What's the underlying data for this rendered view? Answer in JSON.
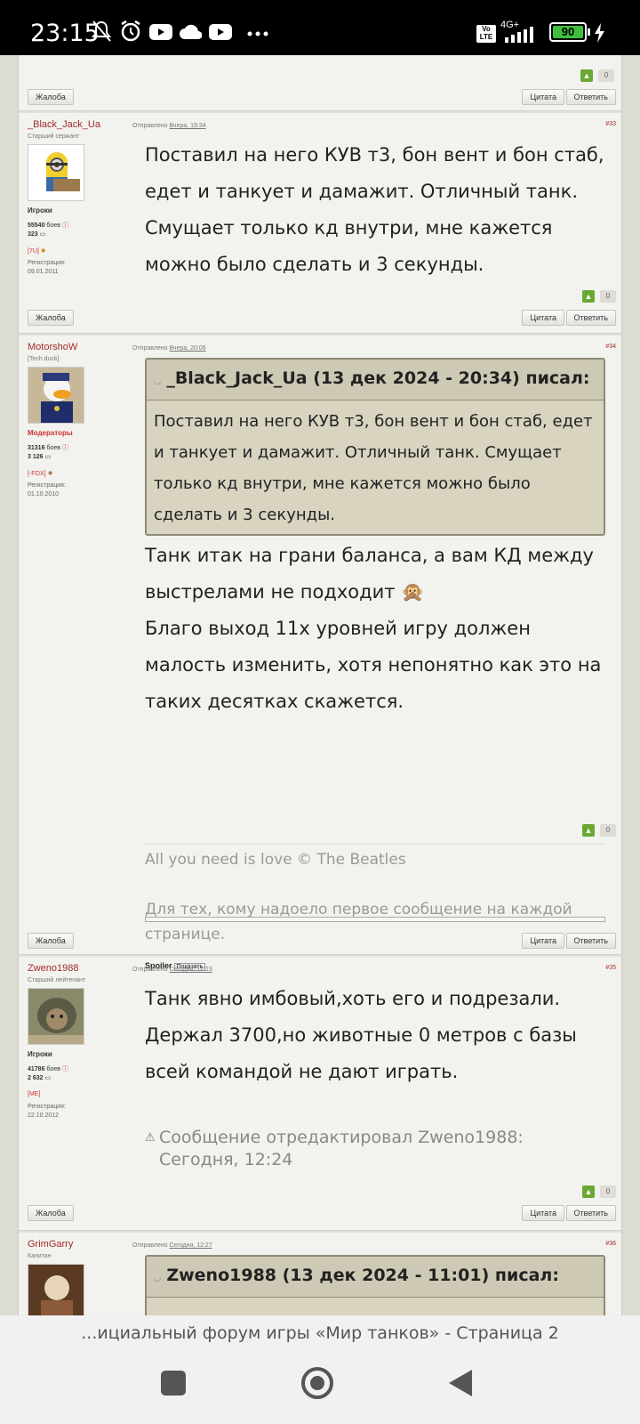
{
  "status_bar": {
    "time": "23:15",
    "battery": "90",
    "network": "4G+",
    "volte": "Vo LTE"
  },
  "forum": {
    "top": {
      "vote_count": "0",
      "report_label": "Жалоба",
      "quote_label": "Цитата",
      "reply_label": "Ответить"
    },
    "posts": [
      {
        "author": "_Black_Jack_Ua",
        "rank": "Старший сержант",
        "group": "Игроки",
        "battles": "55540",
        "battles_label": "боев",
        "posts": "323",
        "clan": "[7U]",
        "reg_label": "Регистрация:",
        "reg_date": "09.01.2011",
        "posted_prefix": "Отправлено",
        "posted_date": "Вчера, 19:34",
        "number": "#33",
        "text": "Поставил на него КУВ т3, бон вент и бон стаб, едет и танкует и дамажит. Отличный танк. Смущает только кд внутри, мне кажется можно было сделать и 3 секунды.",
        "vote_count": "0"
      },
      {
        "author": "MotorshoW",
        "rank": "[Tech duck]",
        "group": "Модераторы",
        "battles": "31316",
        "battles_label": "боев",
        "posts": "3 126",
        "clan": "[-FOX]",
        "reg_label": "Регистрация:",
        "reg_date": "01.10.2010",
        "posted_prefix": "Отправлено",
        "posted_date": "Вчера, 20:06",
        "number": "#34",
        "quote_head": "_Black_Jack_Ua (13 дек 2024 - 20:34) писал:",
        "quote_text": "Поставил на него КУВ т3, бон вент и бон стаб, едет и танкует и дамажит. Отличный танк. Смущает только кд внутри, мне кажется можно было сделать и 3 секунды.",
        "text_1": "Танк итак на грани баланса, а вам КД между выстрелами не подходит",
        "text_2": "Благо выход 11х уровней игру должен малость изменить, хотя непонятно как это на таких десятках скажется.",
        "vote_count": "0",
        "signature_1": "All you need is love © The Beatles",
        "signature_2": "Для тех, кому надоело первое сообщение на каждой странице.",
        "spoiler_label": "Spoiler",
        "spoiler_show": "Показать"
      },
      {
        "author": "Zweno1988",
        "rank": "Старший лейтенант",
        "group": "Игроки",
        "battles": "41786",
        "battles_label": "боев",
        "posts": "2 632",
        "clan": "[ME]",
        "reg_label": "Регистрация:",
        "reg_date": "22.10.2012",
        "posted_prefix": "Отправлено",
        "posted_date": "Сегодня, 12:23",
        "number": "#35",
        "text": "Танк явно имбовый,хоть его и подрезали. Держал 3700,но животные 0 метров с базы всей командой не дают играть.",
        "edited": "Сообщение отредактировал Zweno1988: Сегодня, 12:24",
        "vote_count": "0"
      },
      {
        "author": "GrimGarry",
        "rank": "Капитан",
        "posted_prefix": "Отправлено",
        "posted_date": "Сегодня, 12:27",
        "number": "#36",
        "quote_head": "Zweno1988 (13 дек 2024 - 11:01) писал:"
      }
    ]
  },
  "browser": {
    "title": "...ициальный форум игры «Мир танков» - Страница 2"
  }
}
